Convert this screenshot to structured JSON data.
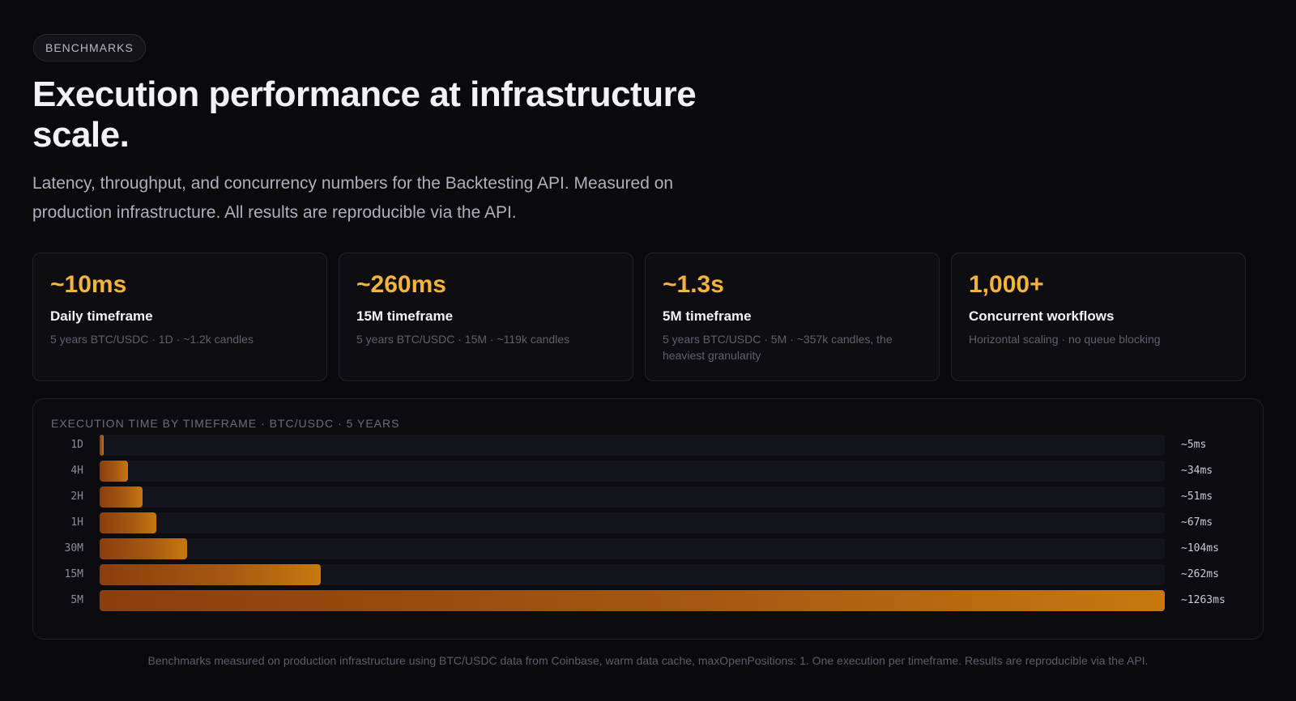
{
  "badge": "BENCHMARKS",
  "heading": "Execution performance at infrastructure scale.",
  "subtitle": "Latency, throughput, and concurrency numbers for the Backtesting API. Measured on production infrastructure. All results are reproducible via the API.",
  "stats": [
    {
      "value": "~10ms",
      "label": "Daily timeframe",
      "desc": "5 years BTC/USDC · 1D · ~1.2k candles"
    },
    {
      "value": "~260ms",
      "label": "15M timeframe",
      "desc": "5 years BTC/USDC · 15M · ~119k candles"
    },
    {
      "value": "~1.3s",
      "label": "5M timeframe",
      "desc": "5 years BTC/USDC · 5M · ~357k candles, the heaviest granularity"
    },
    {
      "value": "1,000+",
      "label": "Concurrent workflows",
      "desc": "Horizontal scaling · no queue blocking"
    }
  ],
  "colors": {
    "accent": "#f4b33a",
    "bar_start": "#8a3e0c",
    "bar_end": "#c8780f"
  },
  "chart_data": {
    "type": "bar",
    "orientation": "horizontal",
    "title": "EXECUTION TIME BY TIMEFRAME · BTC/USDC · 5 YEARS",
    "categories": [
      "1D",
      "4H",
      "2H",
      "1H",
      "30M",
      "15M",
      "5M"
    ],
    "values": [
      5,
      34,
      51,
      67,
      104,
      262,
      1263
    ],
    "value_labels": [
      "~5ms",
      "~34ms",
      "~51ms",
      "~67ms",
      "~104ms",
      "~262ms",
      "~1263ms"
    ],
    "unit": "ms",
    "xlim": [
      0,
      1263
    ]
  },
  "footnote": "Benchmarks measured on production infrastructure using BTC/USDC data from Coinbase, warm data cache, maxOpenPositions: 1. One execution per timeframe. Results are reproducible via the API."
}
